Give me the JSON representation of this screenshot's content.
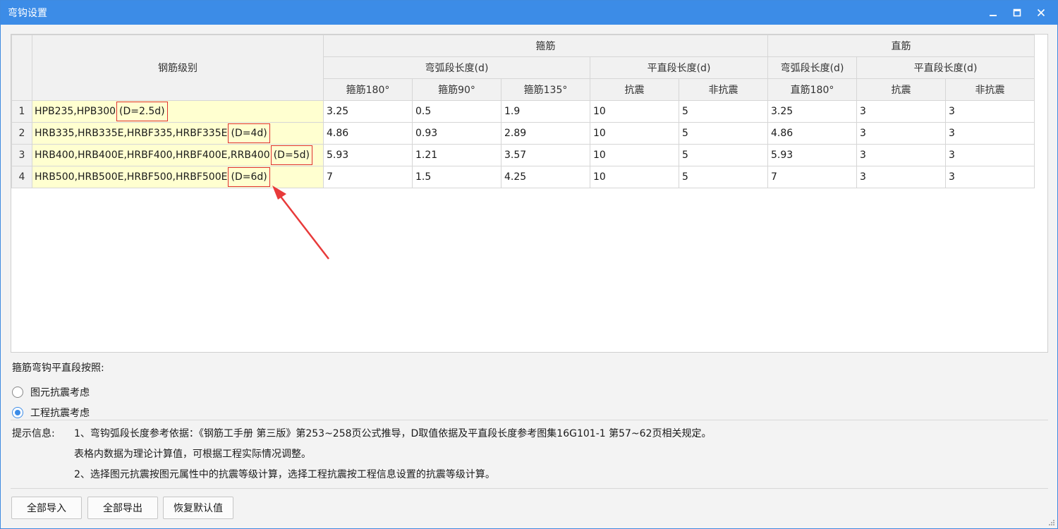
{
  "window": {
    "title": "弯钩设置"
  },
  "table": {
    "header_grade": "钢筋级别",
    "group_stirrup": "箍筋",
    "group_straight": "直筋",
    "sub_arc": "弯弧段长度(d)",
    "sub_flat": "平直段长度(d)",
    "sub_arc2": "弯弧段长度(d)",
    "sub_flat2": "平直段长度(d)",
    "cols": [
      "箍筋180°",
      "箍筋90°",
      "箍筋135°",
      "抗震",
      "非抗震",
      "直筋180°",
      "抗震",
      "非抗震"
    ],
    "rows": [
      {
        "num": "1",
        "grade": "HPB235,HPB300",
        "d": "(D=2.5d)",
        "values": [
          "3.25",
          "0.5",
          "1.9",
          "10",
          "5",
          "3.25",
          "3",
          "3"
        ]
      },
      {
        "num": "2",
        "grade": "HRB335,HRB335E,HRBF335,HRBF335E",
        "d": "(D=4d)",
        "values": [
          "4.86",
          "0.93",
          "2.89",
          "10",
          "5",
          "4.86",
          "3",
          "3"
        ]
      },
      {
        "num": "3",
        "grade": "HRB400,HRB400E,HRBF400,HRBF400E,RRB400",
        "d": "(D=5d)",
        "values": [
          "5.93",
          "1.21",
          "3.57",
          "10",
          "5",
          "5.93",
          "3",
          "3"
        ]
      },
      {
        "num": "4",
        "grade": "HRB500,HRB500E,HRBF500,HRBF500E",
        "d": "(D=6d)",
        "values": [
          "7",
          "1.5",
          "4.25",
          "10",
          "5",
          "7",
          "3",
          "3"
        ]
      }
    ]
  },
  "options": {
    "title": "箍筋弯钩平直段按照:",
    "items": [
      {
        "label": "图元抗震考虑",
        "checked": false
      },
      {
        "label": "工程抗震考虑",
        "checked": true
      }
    ]
  },
  "hints": {
    "label": "提示信息:",
    "line1": "1、弯钩弧段长度参考依据：《钢筋工手册 第三版》第253~258页公式推导，D取值依据及平直段长度参考图集16G101-1 第57~62页相关规定。",
    "line2": "表格内数据为理论计算值，可根据工程实际情况调整。",
    "line3": "2、选择图元抗震按图元属性中的抗震等级计算，选择工程抗震按工程信息设置的抗震等级计算。"
  },
  "buttons": {
    "import_all": "全部导入",
    "export_all": "全部导出",
    "restore_default": "恢复默认值"
  },
  "colors": {
    "titlebar": "#3c8ce7",
    "grade_bg": "#ffffd0",
    "highlight_box": "#e03030",
    "arrow": "#e83a3a"
  }
}
